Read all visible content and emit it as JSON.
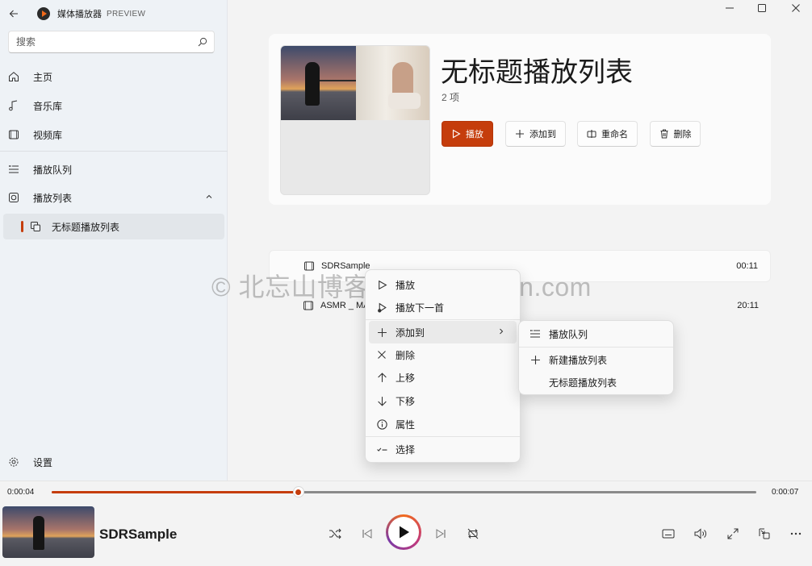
{
  "app": {
    "name": "媒体播放器",
    "tag": "PREVIEW"
  },
  "search": {
    "placeholder": "搜索"
  },
  "nav": {
    "home": "主页",
    "music": "音乐库",
    "video": "视频库",
    "queue": "播放队列",
    "playlists": "播放列表",
    "playlist_item": "无标题播放列表",
    "settings": "设置"
  },
  "playlist": {
    "title": "无标题播放列表",
    "count": "2 项",
    "buttons": {
      "play": "播放",
      "add_to": "添加到",
      "rename": "重命名",
      "delete": "删除"
    }
  },
  "tracks": [
    {
      "name": "SDRSample",
      "duration": "00:11"
    },
    {
      "name": "ASMR _ MA",
      "duration": "20:11"
    }
  ],
  "context_menu": {
    "items": [
      "播放",
      "播放下一首",
      "添加到",
      "删除",
      "上移",
      "下移",
      "属性",
      "选择"
    ]
  },
  "submenu": {
    "items": [
      "播放队列",
      "新建播放列表",
      "无标题播放列表"
    ]
  },
  "watermark": "© 北忘山博客 beiwangshan.com",
  "player": {
    "elapsed": "0:00:04",
    "total": "0:00:07",
    "progress": 0.35,
    "now_playing": "SDRSample"
  },
  "colors": {
    "accent": "#c53d0c",
    "background": "#f3f3f3",
    "sidebar": "#eef2f6"
  }
}
